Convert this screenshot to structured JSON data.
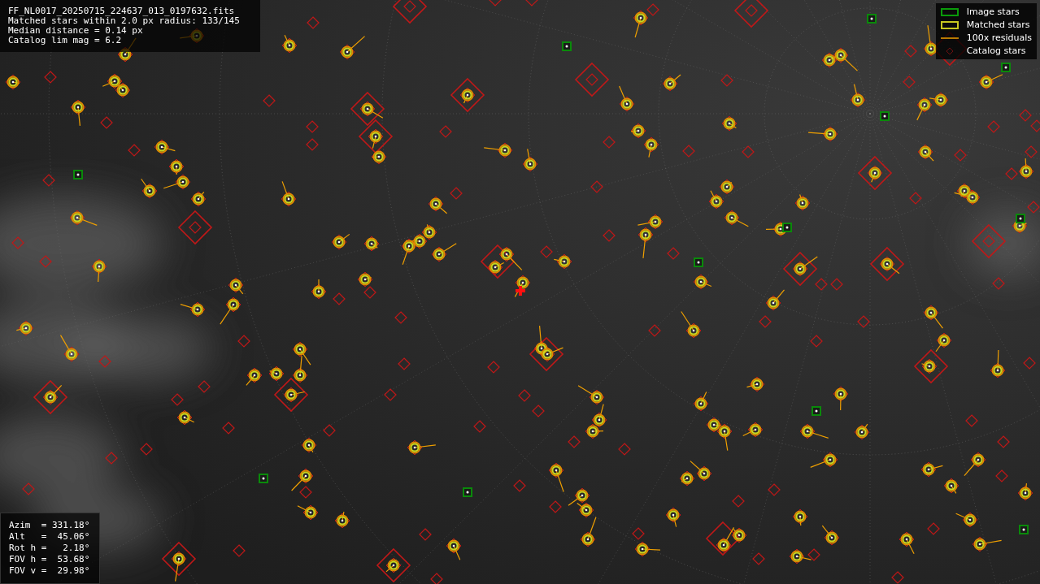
{
  "info_lines": [
    "FF_NL0017_20250715_224637_013_0197632.fits",
    "Matched stars within 2.0 px radius: 133/145",
    "Median distance = 0.14 px",
    "Catalog lim mag = 6.2"
  ],
  "legend": [
    {
      "label": "Image stars",
      "kind": "image"
    },
    {
      "label": "Matched stars",
      "kind": "matched"
    },
    {
      "label": "100x residuals",
      "kind": "residual"
    },
    {
      "label": "Catalog stars",
      "kind": "catalog"
    }
  ],
  "pointing": [
    "Azim  = 331.18°",
    "Alt   =  45.06°",
    "Rot h =   2.18°",
    "FOV h =  53.68°",
    "FOV v =  29.98°"
  ]
}
